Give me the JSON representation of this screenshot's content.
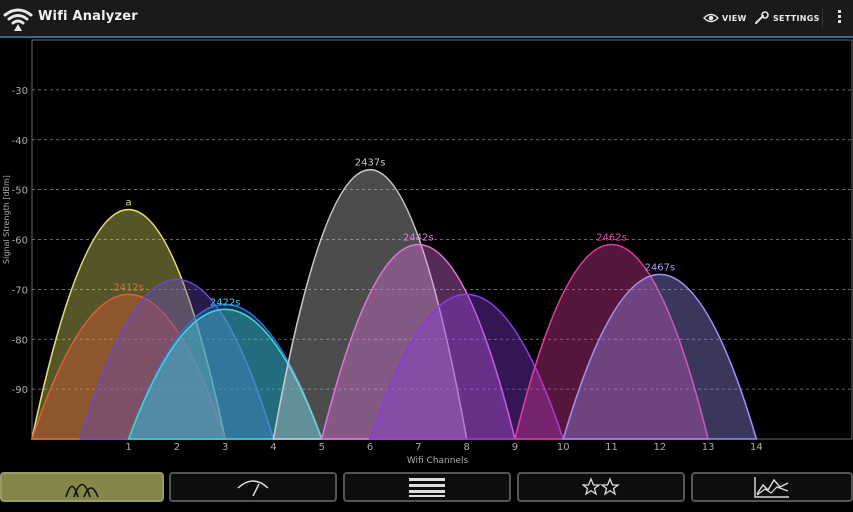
{
  "app": {
    "title": "Wifi Analyzer"
  },
  "actionbar": {
    "view_label": "VIEW",
    "settings_label": "SETTINGS"
  },
  "colors": {
    "accent": "#2d6e8c",
    "tab_active": "#84864a"
  },
  "tabs": [
    {
      "icon": "channel-graph-icon",
      "active": true
    },
    {
      "icon": "signal-meter-icon",
      "active": false
    },
    {
      "icon": "ap-list-icon",
      "active": false
    },
    {
      "icon": "channel-rating-icon",
      "active": false
    },
    {
      "icon": "time-graph-icon",
      "active": false
    }
  ],
  "chart_data": {
    "type": "area",
    "xlabel": "Wifi Channels",
    "ylabel": "Signal Strength [dBm]",
    "x_ticks": [
      1,
      2,
      3,
      4,
      5,
      6,
      7,
      8,
      9,
      10,
      11,
      12,
      13,
      14
    ],
    "y_ticks": [
      -30,
      -40,
      -50,
      -60,
      -70,
      -80,
      -90
    ],
    "xlim": [
      -1,
      16
    ],
    "ylim": [
      -100,
      -20
    ],
    "grid": true,
    "series": [
      {
        "name": "a",
        "channel": 1,
        "level": -54,
        "color": "#e2e06a",
        "label_color": "#e2e06a"
      },
      {
        "name": "2412s",
        "channel": 1,
        "level": -71,
        "color": "#e45a3a",
        "label_color": "#e06a40"
      },
      {
        "name": "",
        "channel": 2,
        "level": -68,
        "color": "#6a48c8",
        "label_color": "#7a5ad0"
      },
      {
        "name": "",
        "channel": 3,
        "level": -73,
        "color": "#2f6fd6",
        "label_color": "#3f80e0"
      },
      {
        "name": "2422s",
        "channel": 3,
        "level": -74,
        "color": "#3fd8c8",
        "label_color": "#3fc8f0"
      },
      {
        "name": "2437s",
        "channel": 6,
        "level": -46,
        "color": "#c8c8c8",
        "label_color": "#c8c8c8"
      },
      {
        "name": "2442s",
        "channel": 7,
        "level": -61,
        "color": "#e070e0",
        "label_color": "#e878e8"
      },
      {
        "name": "",
        "channel": 8,
        "level": -71,
        "color": "#8a3ae0",
        "label_color": "#9a4ae8"
      },
      {
        "name": "2462s",
        "channel": 11,
        "level": -61,
        "color": "#e03a9a",
        "label_color": "#f04aa8"
      },
      {
        "name": "2467s",
        "channel": 12,
        "level": -67,
        "color": "#9a8ef0",
        "label_color": "#a89af8"
      }
    ]
  }
}
